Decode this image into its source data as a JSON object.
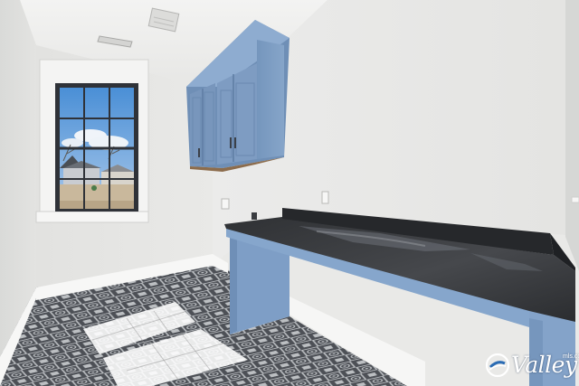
{
  "watermark": {
    "brand": "Valley",
    "suffix": "mls.com"
  },
  "colors": {
    "cabinet_blue": "#7e9fc4",
    "countertop": "#3a3c40",
    "wall": "#ededeb",
    "floor_tile_dark": "#4e5258",
    "floor_tile_light": "#c9ccd0"
  }
}
